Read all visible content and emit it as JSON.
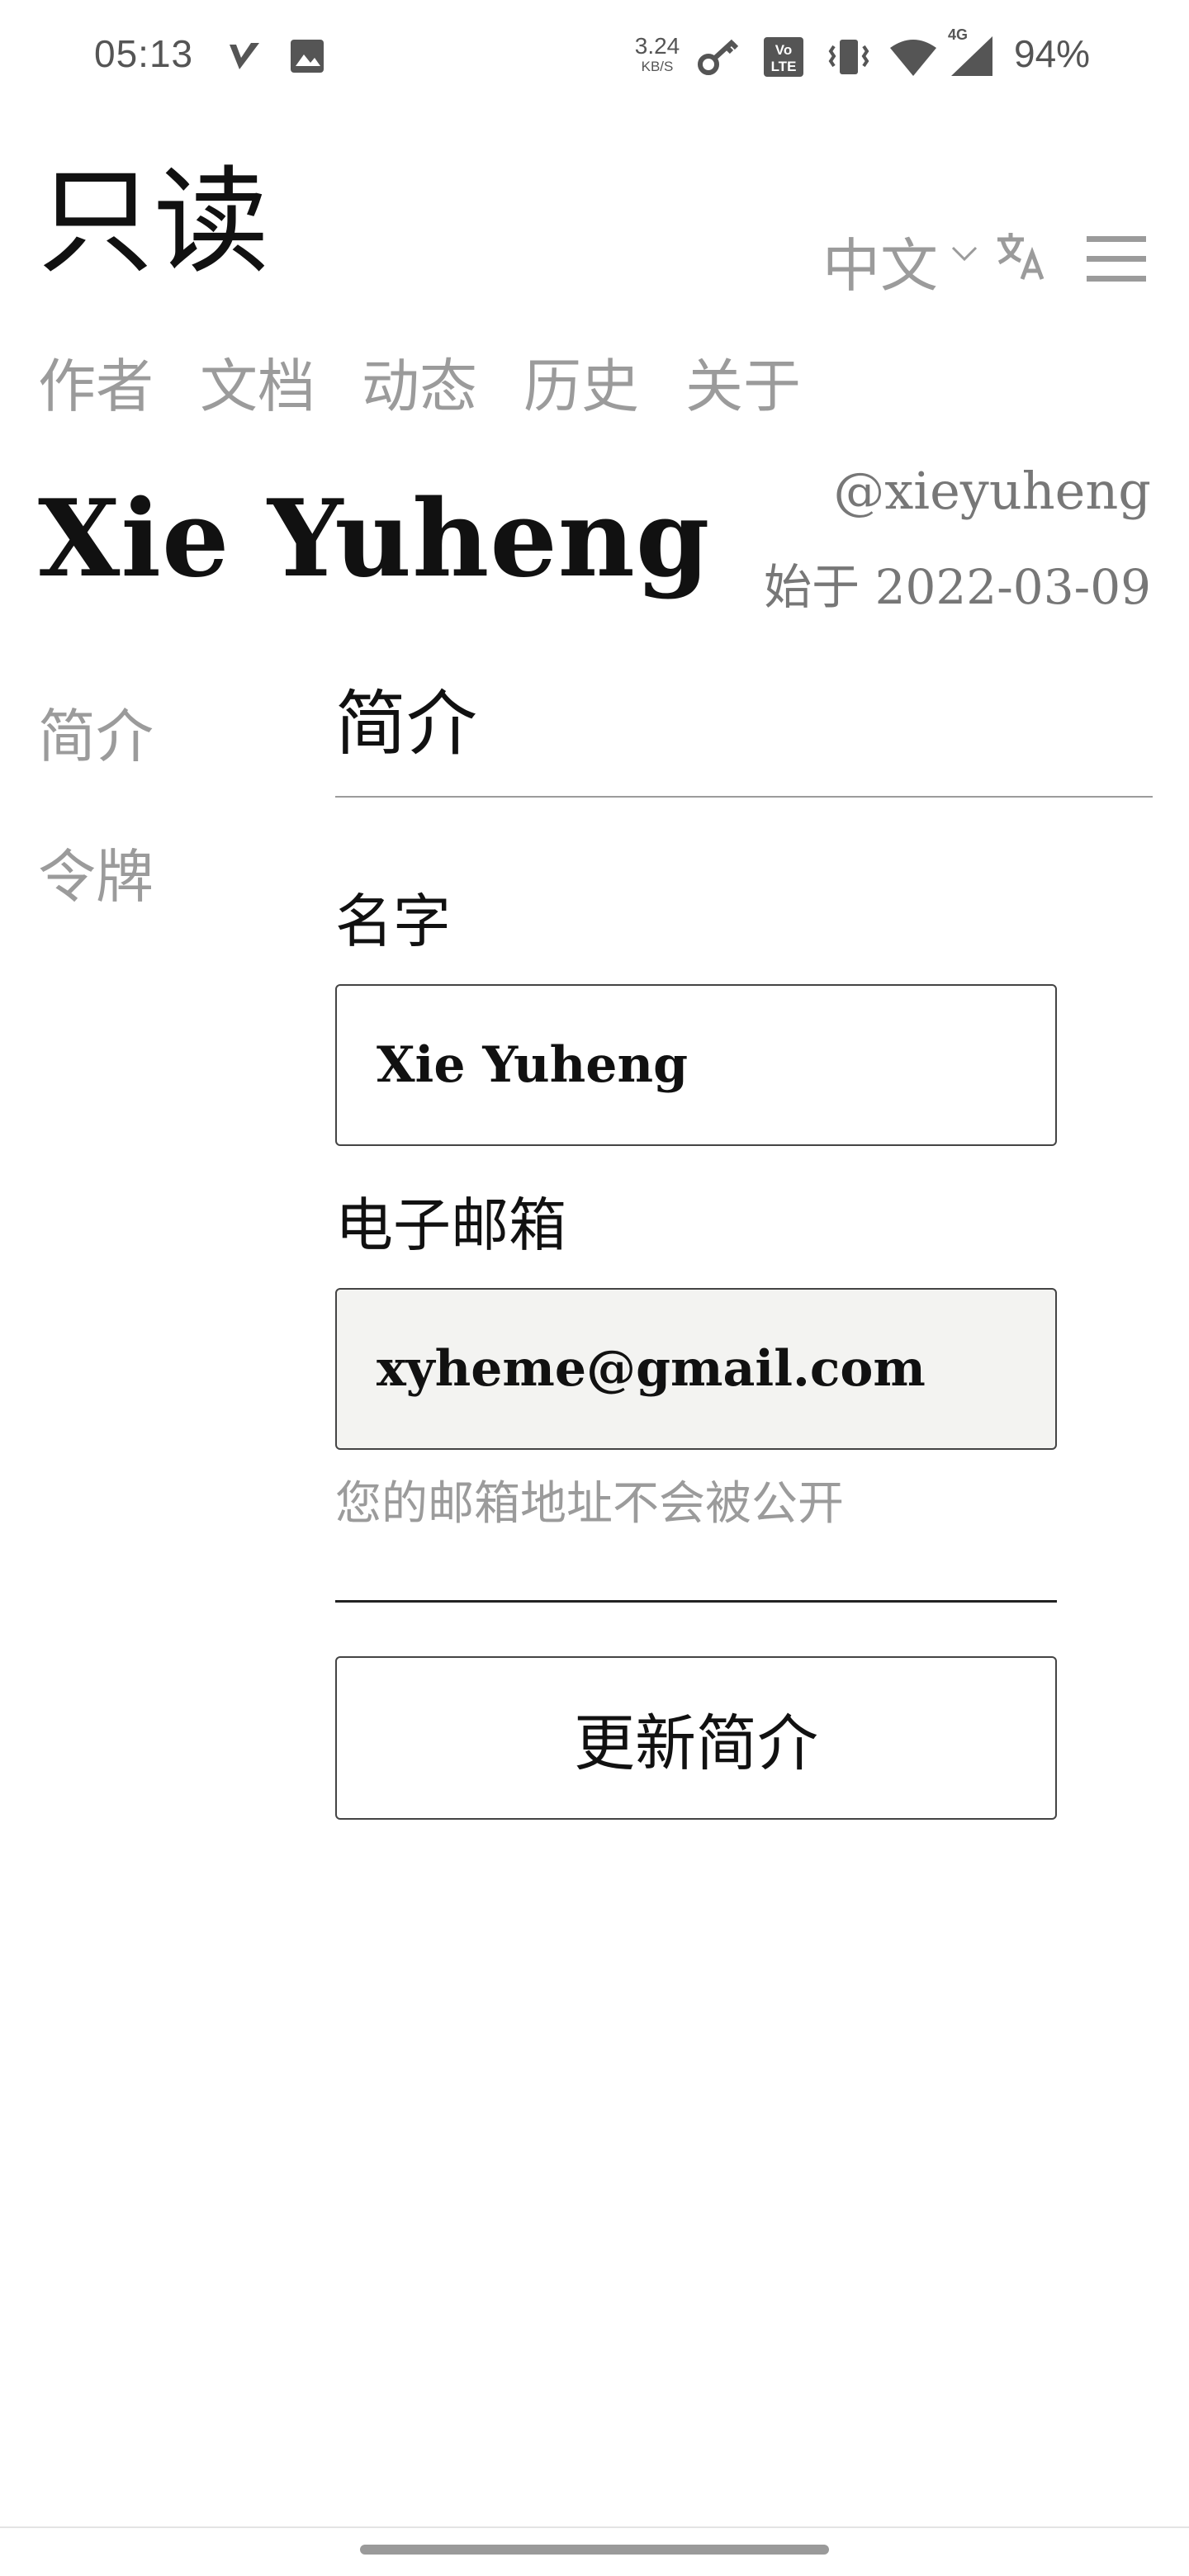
{
  "status_bar": {
    "time": "05:13",
    "net_speed_value": "3.24",
    "net_speed_unit": "KB/S",
    "network": "4G",
    "battery": "94%"
  },
  "header": {
    "logo": "只读",
    "language": "中文"
  },
  "nav": [
    "作者",
    "文档",
    "动态",
    "历史",
    "关于"
  ],
  "author": {
    "name": "Xie Yuheng",
    "handle": "@xieyuheng",
    "since": "始于 2022-03-09"
  },
  "side_menu": [
    "简介",
    "令牌"
  ],
  "profile_form": {
    "section_title": "简介",
    "name_label": "名字",
    "name_value": "Xie Yuheng",
    "email_label": "电子邮箱",
    "email_value": "xyheme@gmail.com",
    "email_hint": "您的邮箱地址不会被公开",
    "submit_label": "更新简介"
  },
  "icons": {
    "status": [
      "vpn-check-icon",
      "image-icon",
      "key-icon",
      "volte-icon",
      "vibrate-icon",
      "wifi-icon",
      "signal-icon"
    ],
    "header": [
      "chevron-down-icon",
      "translate-icon",
      "menu-icon"
    ]
  }
}
